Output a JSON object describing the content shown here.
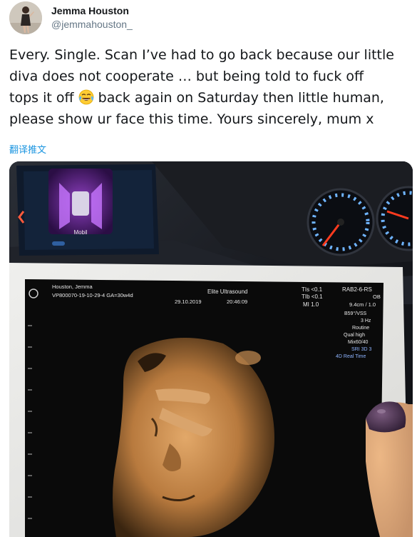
{
  "author": {
    "display_name": "Jemma Houston",
    "handle": "@jemmahouston_"
  },
  "tweet": {
    "text_part1": "Every. Single. Scan I’ve had to go back because our little\ndiva does not cooperate … but being told to fuck off\ntops it off ",
    "emoji": "face-with-tears-of-joy",
    "text_part2": " back again on Saturday then little human,\nplease show ur face this time.  Yours sincerely, mum x",
    "translate_label": "翻译推文"
  },
  "photo": {
    "dashboard_screen_label": "Mobil",
    "scan_header": {
      "patient": "Houston, Jemma",
      "id_line": "VP800070-19-10-29-4 GA=30w4d",
      "clinic": "Elite Ultrasound",
      "date": "29.10.2019",
      "time": "20:46:09",
      "tis": "TIs <0.1",
      "tib": "TIb <0.1",
      "mi": "MI 1.0",
      "probe": "RAB2-6-RS",
      "ob": "OB",
      "depth": "9.4cm / 1.0",
      "angle": "B59°/VSS",
      "freq": "3 Hz",
      "routine": "Routine",
      "quality": "Qual high",
      "mix": "Mix60/40",
      "sri": "SRI 3D 3",
      "mode": "4D Real Time"
    }
  },
  "colors": {
    "link": "#1b95e0",
    "text": "#14171a",
    "secondary": "#657786",
    "mode_text": "#8fb4ff"
  }
}
